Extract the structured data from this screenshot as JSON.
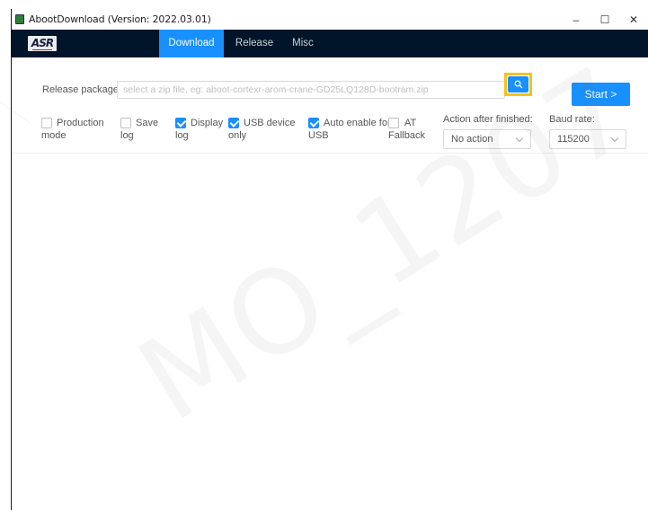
{
  "window": {
    "title": "AbootDownload (Version: 2022.03.01)",
    "controls": {
      "minimize": "–",
      "maximize": "☐",
      "close": "✕"
    }
  },
  "nav": {
    "logo": "ASR",
    "items": [
      {
        "label": "Download",
        "active": true
      },
      {
        "label": "Release",
        "active": false
      },
      {
        "label": "Misc",
        "active": false
      }
    ]
  },
  "form": {
    "release_label": "Release package:",
    "release_value": "",
    "release_placeholder": "select a zip file, eg: aboot-cortexr-arom-crane-GD25LQ128D-bootram.zip",
    "search_icon": "search-icon",
    "start_label": "Start  >",
    "checkboxes": [
      {
        "line1": "Production",
        "line2": "mode",
        "checked": false
      },
      {
        "line1": "Save",
        "line2": "log",
        "checked": false
      },
      {
        "line1": "Display",
        "line2": "log",
        "checked": true
      },
      {
        "line1": "USB device",
        "line2": "only",
        "checked": true
      },
      {
        "line1": "Auto enable for",
        "line2": "USB",
        "checked": true
      },
      {
        "line1": "AT",
        "line2": "Fallback",
        "checked": false
      }
    ],
    "action_label": "Action after finished:",
    "action_value": "No action",
    "baud_label": "Baud rate:",
    "baud_value": "115200"
  },
  "watermark": "MO_1207",
  "colors": {
    "accent": "#1890ff",
    "nav_bg": "#001529",
    "highlight": "#f7c21a"
  }
}
